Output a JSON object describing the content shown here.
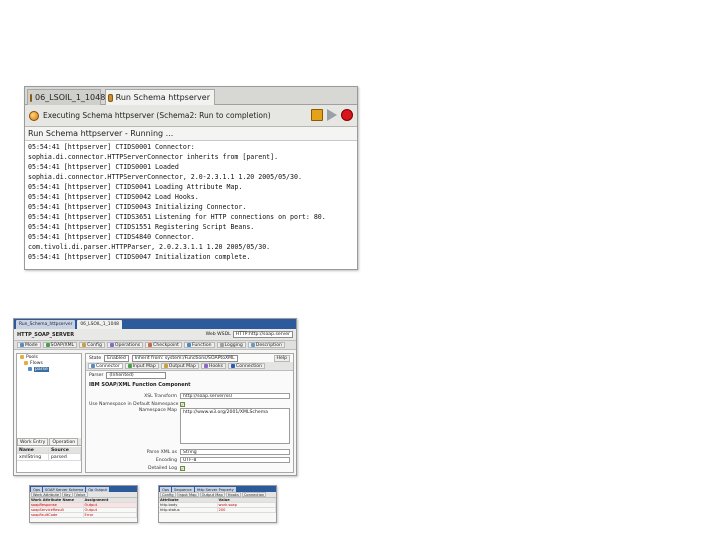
{
  "console": {
    "tabs": [
      {
        "label": "06_LSOIL_1_1048",
        "active": false
      },
      {
        "label": "Run Schema httpserver",
        "active": true
      }
    ],
    "exec_text": "Executing Schema httpserver (Schema2: Run to completion)",
    "status": "Run Schema httpserver - Running ...",
    "log_lines": [
      "05:54:41  [httpserver]  CTIDS0001  Connector:",
      "sophia.di.connector.HTTPServerConnector inherits from [parent].",
      "05:54:41  [httpserver]  CTIDS0001  Loaded",
      "sophia.di.connector.HTTPServerConnector, 2.0-2.3.1.1 1.20 2005/05/30.",
      "05:54:41  [httpserver]  CTIDS0041  Loading Attribute Map.",
      "05:54:41  [httpserver]  CTIDS0042  Load Hooks.",
      "05:54:41  [httpserver]  CTIDS0043  Initializing Connector.",
      "05:54:41  [httpserver]  CTIDS3651  Listening for HTTP connections on port: 80.",
      "05:54:41  [httpserver]  CTIDS1551  Registering Script Beans.",
      "05:54:41  [httpserver]  CTIDS4840  Connector.",
      "com.tivoli.di.parser.HTTPParser, 2.0.2.3.1.1 1.20 2005/05/30.",
      "05:54:41  [httpserver]  CTIDS0047  Initialization complete."
    ]
  },
  "editor": {
    "tabs": [
      "Run_Schema_httpserver",
      "06_LSOIL_1_1048"
    ],
    "title": "HTTP_SOAP_SERVER",
    "web_service_label": "Web WSDL",
    "web_service_value": "HTTP:http://soap.server",
    "toolbar": [
      "Mode",
      "SOAP/XML",
      "Config",
      "Operations",
      "Checkpoint",
      "Function",
      "Logging",
      "Description"
    ],
    "help_label": "Help",
    "mode_label": "State",
    "mode_value": "Enabled",
    "inherit_label": "Inherit from: system:/Functions/SOAPtoXML",
    "tree": [
      "Pools",
      "Flows",
      "parse"
    ],
    "left_tabs": [
      "Work Entry",
      "Operation"
    ],
    "prop_head": [
      "Name",
      "Source"
    ],
    "prop_rows": [
      [
        "xmlString",
        "parsed"
      ]
    ],
    "subtabs": [
      "Connector",
      "Input Map",
      "Output Map",
      "Hooks",
      "Connection"
    ],
    "parser_label": "Parser",
    "parser_value": "(Inherited)",
    "form_heading": "IBM SOAP/XML Function Component",
    "fields": {
      "xsl_label": "XSL Transform",
      "xsl_value": "http://soap.server/xsl",
      "use_soap_label": "Use Namespace in Default Namespace",
      "namespace_label": "Namespace Map",
      "namespace_value": "http://www.w3.org/2001/XMLSchema",
      "fromxml_label": "Parse XML as",
      "fromxml_value": "String",
      "encoding_label": "Encoding",
      "encoding_value": "UTF-8",
      "debug_label": "Detailed Log"
    }
  },
  "thumb_left": {
    "tabs": [
      "Ops",
      "SOAP Server Schema",
      "Op Output"
    ],
    "tools": [
      "Work Attribute",
      "Key",
      "Value"
    ],
    "head": [
      "Work Attribute Name",
      "Assignment"
    ],
    "rows": [
      [
        "soapResponse",
        "Output"
      ],
      [
        "soapServiceResult",
        "Output"
      ],
      [
        "soapFaultCode",
        "Error"
      ]
    ]
  },
  "thumb_right": {
    "tabs": [
      "Ops",
      "Sequence",
      "Http Server Property"
    ],
    "tools": [
      "Config",
      "Input Map",
      "Output Map",
      "Hooks",
      "Connection"
    ],
    "head": [
      "Attribute",
      "Value"
    ],
    "rows": [
      [
        "http.body",
        "work.soap"
      ],
      [
        "http.status",
        "200"
      ]
    ]
  }
}
